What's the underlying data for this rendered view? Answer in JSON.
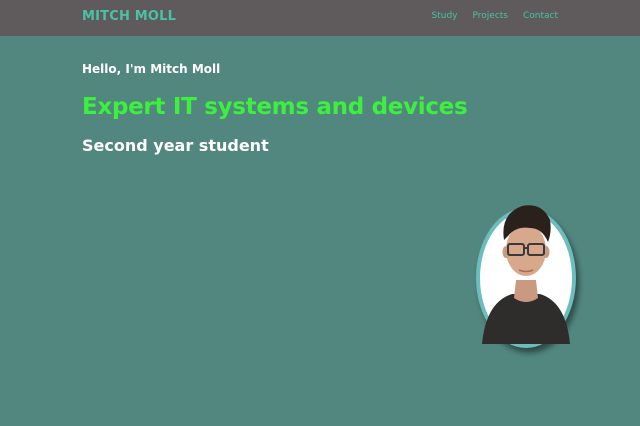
{
  "header": {
    "brand": "MITCH MOLL",
    "nav": [
      {
        "label": "Study"
      },
      {
        "label": "Projects"
      },
      {
        "label": "Contact"
      }
    ]
  },
  "hero": {
    "greeting": "Hello, I'm Mitch Moll",
    "headline": "Expert IT systems and devices",
    "subheadline": "Second year student"
  },
  "colors": {
    "background": "#52877f",
    "navbar": "#5f5a5b",
    "accent": "#49c2a6",
    "headline": "#3df03d",
    "avatar_ring": "#6bbdbe"
  }
}
